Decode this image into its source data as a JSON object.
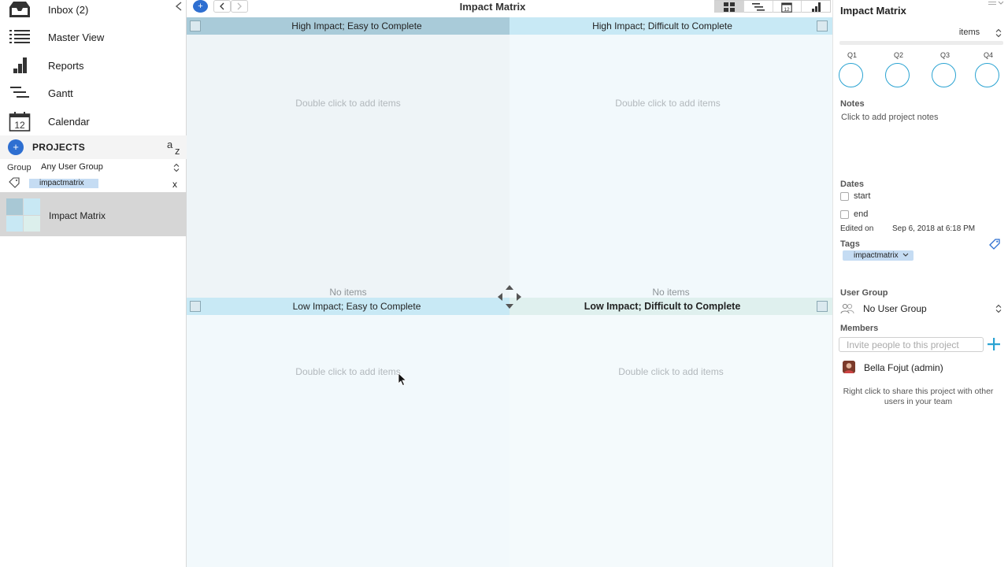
{
  "sidebar": {
    "nav": [
      {
        "label": "Inbox (2)",
        "icon": "inbox-icon"
      },
      {
        "label": "Master View",
        "icon": "list-icon"
      },
      {
        "label": "Reports",
        "icon": "bar-chart-icon"
      },
      {
        "label": "Gantt",
        "icon": "gantt-icon"
      },
      {
        "label": "Calendar",
        "icon": "calendar-icon",
        "calendar_day": "12"
      }
    ],
    "projects_title": "PROJECTS",
    "add_symbol": "+",
    "sort": {
      "a": "a",
      "z": "z"
    },
    "group_label": "Group",
    "group_value": "Any User Group",
    "tag_filter": "impactmatrix",
    "tag_clear": "x",
    "project_name": "Impact Matrix"
  },
  "toolbar": {
    "add_symbol": "+",
    "back": "<",
    "forward": ">",
    "title": "Impact Matrix"
  },
  "matrix": {
    "quadrants": [
      {
        "title": "High Impact; Easy to Complete",
        "empty_hint": "Double click to add items",
        "no_items": ""
      },
      {
        "title": "High Impact; Difficult to Complete",
        "empty_hint": "Double click to add items",
        "no_items": ""
      },
      {
        "title": "Low Impact; Easy to Complete",
        "empty_hint": "Double click to add items",
        "no_items": "No items"
      },
      {
        "title": "Low Impact; Difficult to Complete",
        "empty_hint": "Double click to add items",
        "no_items": "No items"
      }
    ]
  },
  "inspector": {
    "title": "Impact Matrix",
    "items_select": "items",
    "quadrant_labels": [
      "Q1",
      "Q2",
      "Q3",
      "Q4"
    ],
    "notes_label": "Notes",
    "notes_placeholder": "Click to add project notes",
    "dates_label": "Dates",
    "start_label": "start",
    "end_label": "end",
    "edited_label": "Edited on",
    "edited_value": "Sep 6, 2018 at 6:18 PM",
    "tags_label": "Tags",
    "tag": "impactmatrix",
    "user_group_label": "User Group",
    "user_group_value": "No User Group",
    "members_label": "Members",
    "invite_placeholder": "Invite people to this project",
    "member": "Bella Fojut (admin)",
    "share_hint": "Right click to share this project with other users in your team"
  },
  "colors": {
    "accent": "#2e6fd1",
    "circle": "#2aa3d2",
    "q1_header": "#a9cbd9",
    "q2_header": "#c8e9f5",
    "q4_header": "#dff0ee",
    "tag_bg": "#c5dcf3"
  }
}
